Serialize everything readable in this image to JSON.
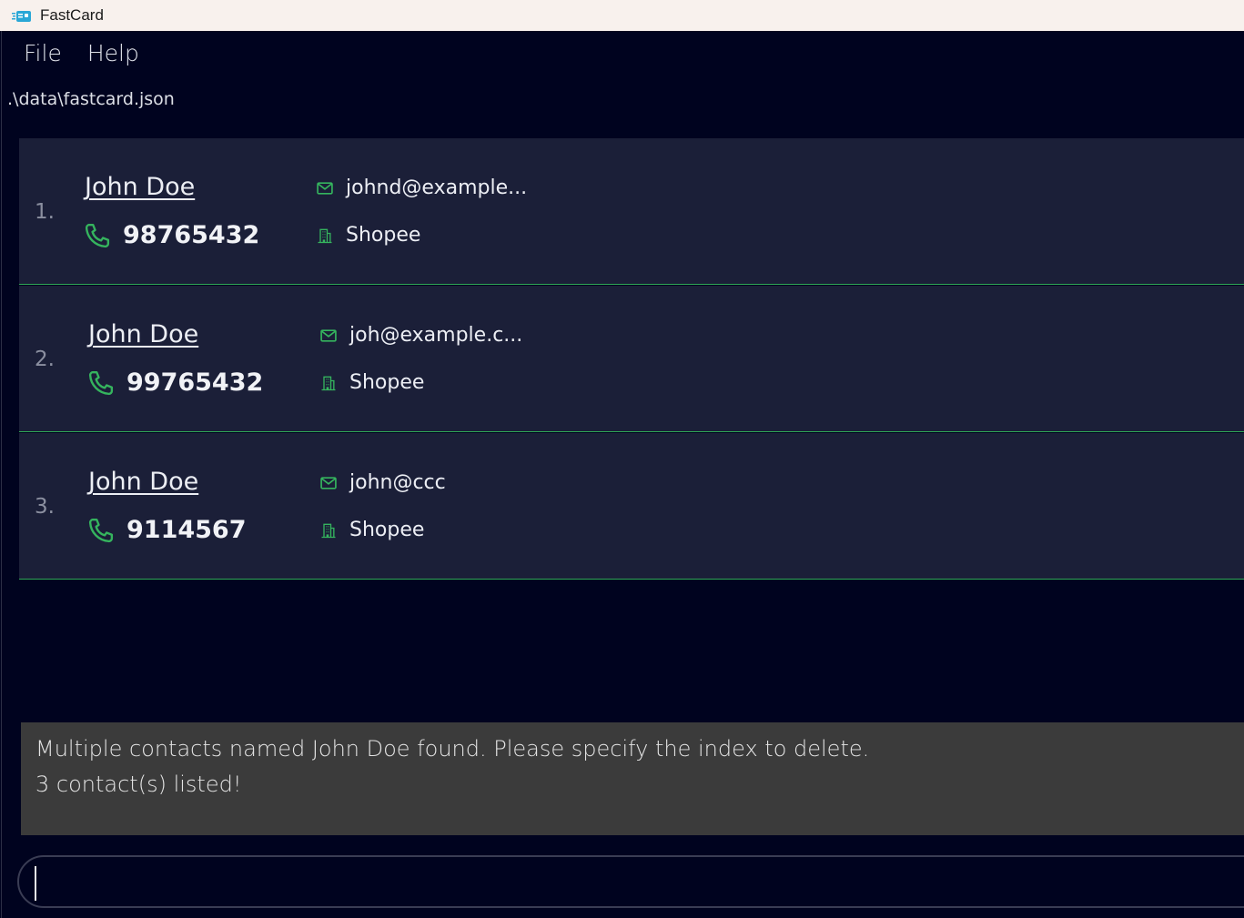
{
  "window": {
    "title": "FastCard"
  },
  "menu": {
    "file": "File",
    "help": "Help"
  },
  "storage_path": ".\\data\\fastcard.json",
  "contacts": [
    {
      "index": "1.",
      "name": "John Doe",
      "phone": "98765432",
      "email": "johnd@example...",
      "company": "Shopee"
    },
    {
      "index": "2.",
      "name": "John Doe",
      "phone": "99765432",
      "email": "joh@example.c...",
      "company": "Shopee"
    },
    {
      "index": "3.",
      "name": "John Doe",
      "phone": "9114567",
      "email": "john@ccc",
      "company": "Shopee"
    }
  ],
  "result": {
    "line1": "Multiple contacts named John Doe found. Please specify the index to delete.",
    "line2": "3 contact(s) listed!"
  },
  "command": {
    "value": ""
  },
  "colors": {
    "background": "#00031f",
    "card": "#1b1f38",
    "accent_green": "#2fa856",
    "result_bg": "#3b3b3b"
  },
  "icons": {
    "phone": "phone-icon",
    "email": "mail-icon",
    "company": "building-icon"
  }
}
